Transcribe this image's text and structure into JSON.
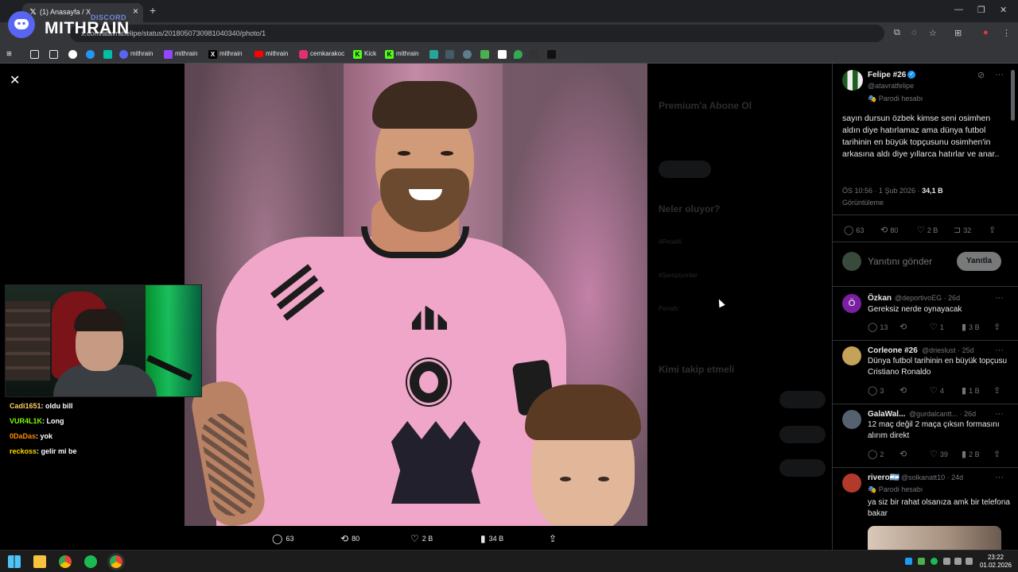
{
  "browser": {
    "tab_title": "(1) Anasayfa / X",
    "url": "x.com/atavratfelipe/status/2018050730981040340/photo/1",
    "bookmarks": [
      {
        "label": "mithrain",
        "icon": "discord-icon",
        "color": "#5865f2"
      },
      {
        "label": "mithrain",
        "icon": "twitch-icon",
        "color": "#9146ff"
      },
      {
        "label": "mithrain",
        "icon": "x-icon",
        "color": "#000000"
      },
      {
        "label": "mithrain",
        "icon": "youtube-icon",
        "color": "#ff0000"
      },
      {
        "label": "cemkarakoc",
        "icon": "instagram-icon",
        "color": "#e1306c"
      },
      {
        "label": "Kick",
        "icon": "kick-icon",
        "color": "#53fc18"
      },
      {
        "label": "mithrain",
        "icon": "kick-icon",
        "color": "#53fc18"
      }
    ]
  },
  "overlay": {
    "logo_sub": "DISCORD",
    "logo_main": "MITHRAIN"
  },
  "photo_actions": {
    "replies": "63",
    "reposts": "80",
    "likes": "2 B",
    "views": "34 B"
  },
  "tweet": {
    "author_name": "Felipe #26",
    "author_handle": "@atavratfelipe",
    "parody_label": "Parodi hesabı",
    "text": "sayın dursun özbek kimse seni osimhen aldın diye hatırlamaz ama dünya futbol tarihinin en büyük topçusunu osimhen'in arkasına aldı diye yıllarca hatırlar ve anar..",
    "time": "ÖS 10:56 · 1 Şub 2026 · ",
    "views_count": "34,1 B",
    "views_label": "Görüntüleme",
    "stats": {
      "replies": "63",
      "reposts": "80",
      "likes": "2 B",
      "bookmarks": "32"
    },
    "reply_placeholder": "Yanıtını gönder",
    "reply_button": "Yanıtla"
  },
  "replies": [
    {
      "name": "Özkan",
      "handle": "@deportivoEG · 26d",
      "text": "Gereksiz nerde oynayacak",
      "replies": "13",
      "likes": "1",
      "views": "3 B",
      "avatar_letter": "Ö",
      "avatar_color": "#7b1fa2"
    },
    {
      "name": "Corleone #26",
      "handle": "@drieslust · 25d",
      "text": "Dünya futbol tarihinin en büyük topçusu Cristiano Ronaldo",
      "replies": "3",
      "likes": "4",
      "views": "1 B",
      "avatar_letter": "",
      "avatar_color": "#c4a25a"
    },
    {
      "name": "GalaWal...",
      "handle": "@gurdalcantt... · 26d",
      "text": "12 maç değil 2 maça çıksın formasını alırım direkt",
      "replies": "2",
      "likes": "39",
      "views": "2 B",
      "avatar_letter": "",
      "avatar_color": "#556070"
    },
    {
      "name": "rivero🇦🇷",
      "handle": "@solkanatt10 · 24d",
      "parody": "Parodi hesabı",
      "text": "ya siz bir rahat olsanıza amk bir telefona bakar",
      "avatar_letter": "",
      "avatar_color": "#b23a2a"
    }
  ],
  "dim_panel": {
    "premium_title": "Premium'a Abone Ol",
    "trends_title": "Neler oluyor?",
    "trend1": "#PetaliK",
    "trend2": "#Şampiyonlar",
    "trend3": "Penaltı",
    "follow_title": "Kimi takip etmeli"
  },
  "chat": [
    {
      "user": "Cadi1651",
      "color": "#ffd166",
      "msg": ": oldu bill"
    },
    {
      "user": "VUR4L1K",
      "color": "#7cfc00",
      "msg": ": Long"
    },
    {
      "user": "0DaDas",
      "color": "#ff8c00",
      "msg": ": yok"
    },
    {
      "user": "reckoss",
      "color": "#ffd700",
      "msg": ": gelir mi be"
    }
  ],
  "taskbar": {
    "time": "23:22",
    "date": "01.02.2026"
  }
}
